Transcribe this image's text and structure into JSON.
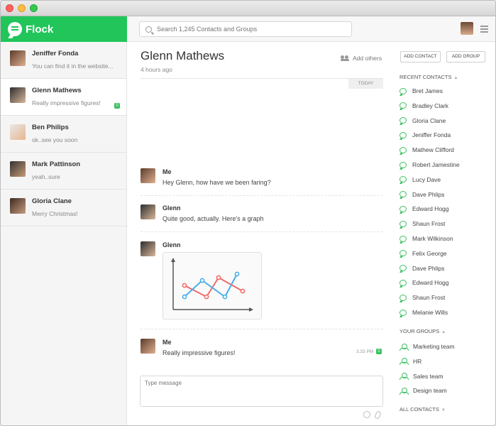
{
  "app": {
    "name": "Flock"
  },
  "search": {
    "placeholder": "Search 1,245 Contacts and Groups"
  },
  "conversations": [
    {
      "name": "Jeniffer Fonda",
      "preview": "You can find it in the website..."
    },
    {
      "name": "Glenn Mathews",
      "preview": "Really impressive figures!",
      "badge": "0"
    },
    {
      "name": "Ben Philips",
      "preview": "ok..see you soon"
    },
    {
      "name": "Mark Pattinson",
      "preview": "yeah..sure"
    },
    {
      "name": "Gloria Clane",
      "preview": "Merry Christmas!"
    }
  ],
  "chat": {
    "title": "Glenn Mathews",
    "subtitle": "4 hours ago",
    "add_others": "Add others",
    "day": "TODAY",
    "messages": [
      {
        "sender": "Me",
        "text": "Hey Glenn, how have we been faring?"
      },
      {
        "sender": "Glenn",
        "text": "Quite good, actually. Here's a graph"
      },
      {
        "sender": "Glenn",
        "text": ""
      },
      {
        "sender": "Me",
        "text": "Really impressive figures!",
        "time": "3.33 PM",
        "check": "0"
      }
    ],
    "composer_placeholder": "Type message"
  },
  "right_panel": {
    "add_contact": "ADD CONTACT",
    "add_group": "ADD GROUP",
    "recent_contacts_header": "RECENT CONTACTS",
    "recent_contacts": [
      "Bret James",
      "Bradley Clark",
      "Gloria Clane",
      "Jeniffer Fonda",
      "Mathew Clifford",
      "Robert Jamestine",
      "Lucy Dave",
      "Dave Phlips",
      "Edward Hogg",
      "Shaun Frost",
      "Mark Wilkinson",
      "Felix George",
      "Dave Phlips",
      "Edward Hogg",
      "Shaun Frost",
      "Melanie Wills"
    ],
    "groups_header": "YOUR GROUPS",
    "groups": [
      "Marketing team",
      "HR",
      "Sales team",
      "Design team"
    ],
    "all_contacts_header": "ALL CONTACTS"
  },
  "colors": {
    "brand": "#21c55a",
    "graph_red": "#f06a6a",
    "graph_blue": "#4aaee8"
  }
}
